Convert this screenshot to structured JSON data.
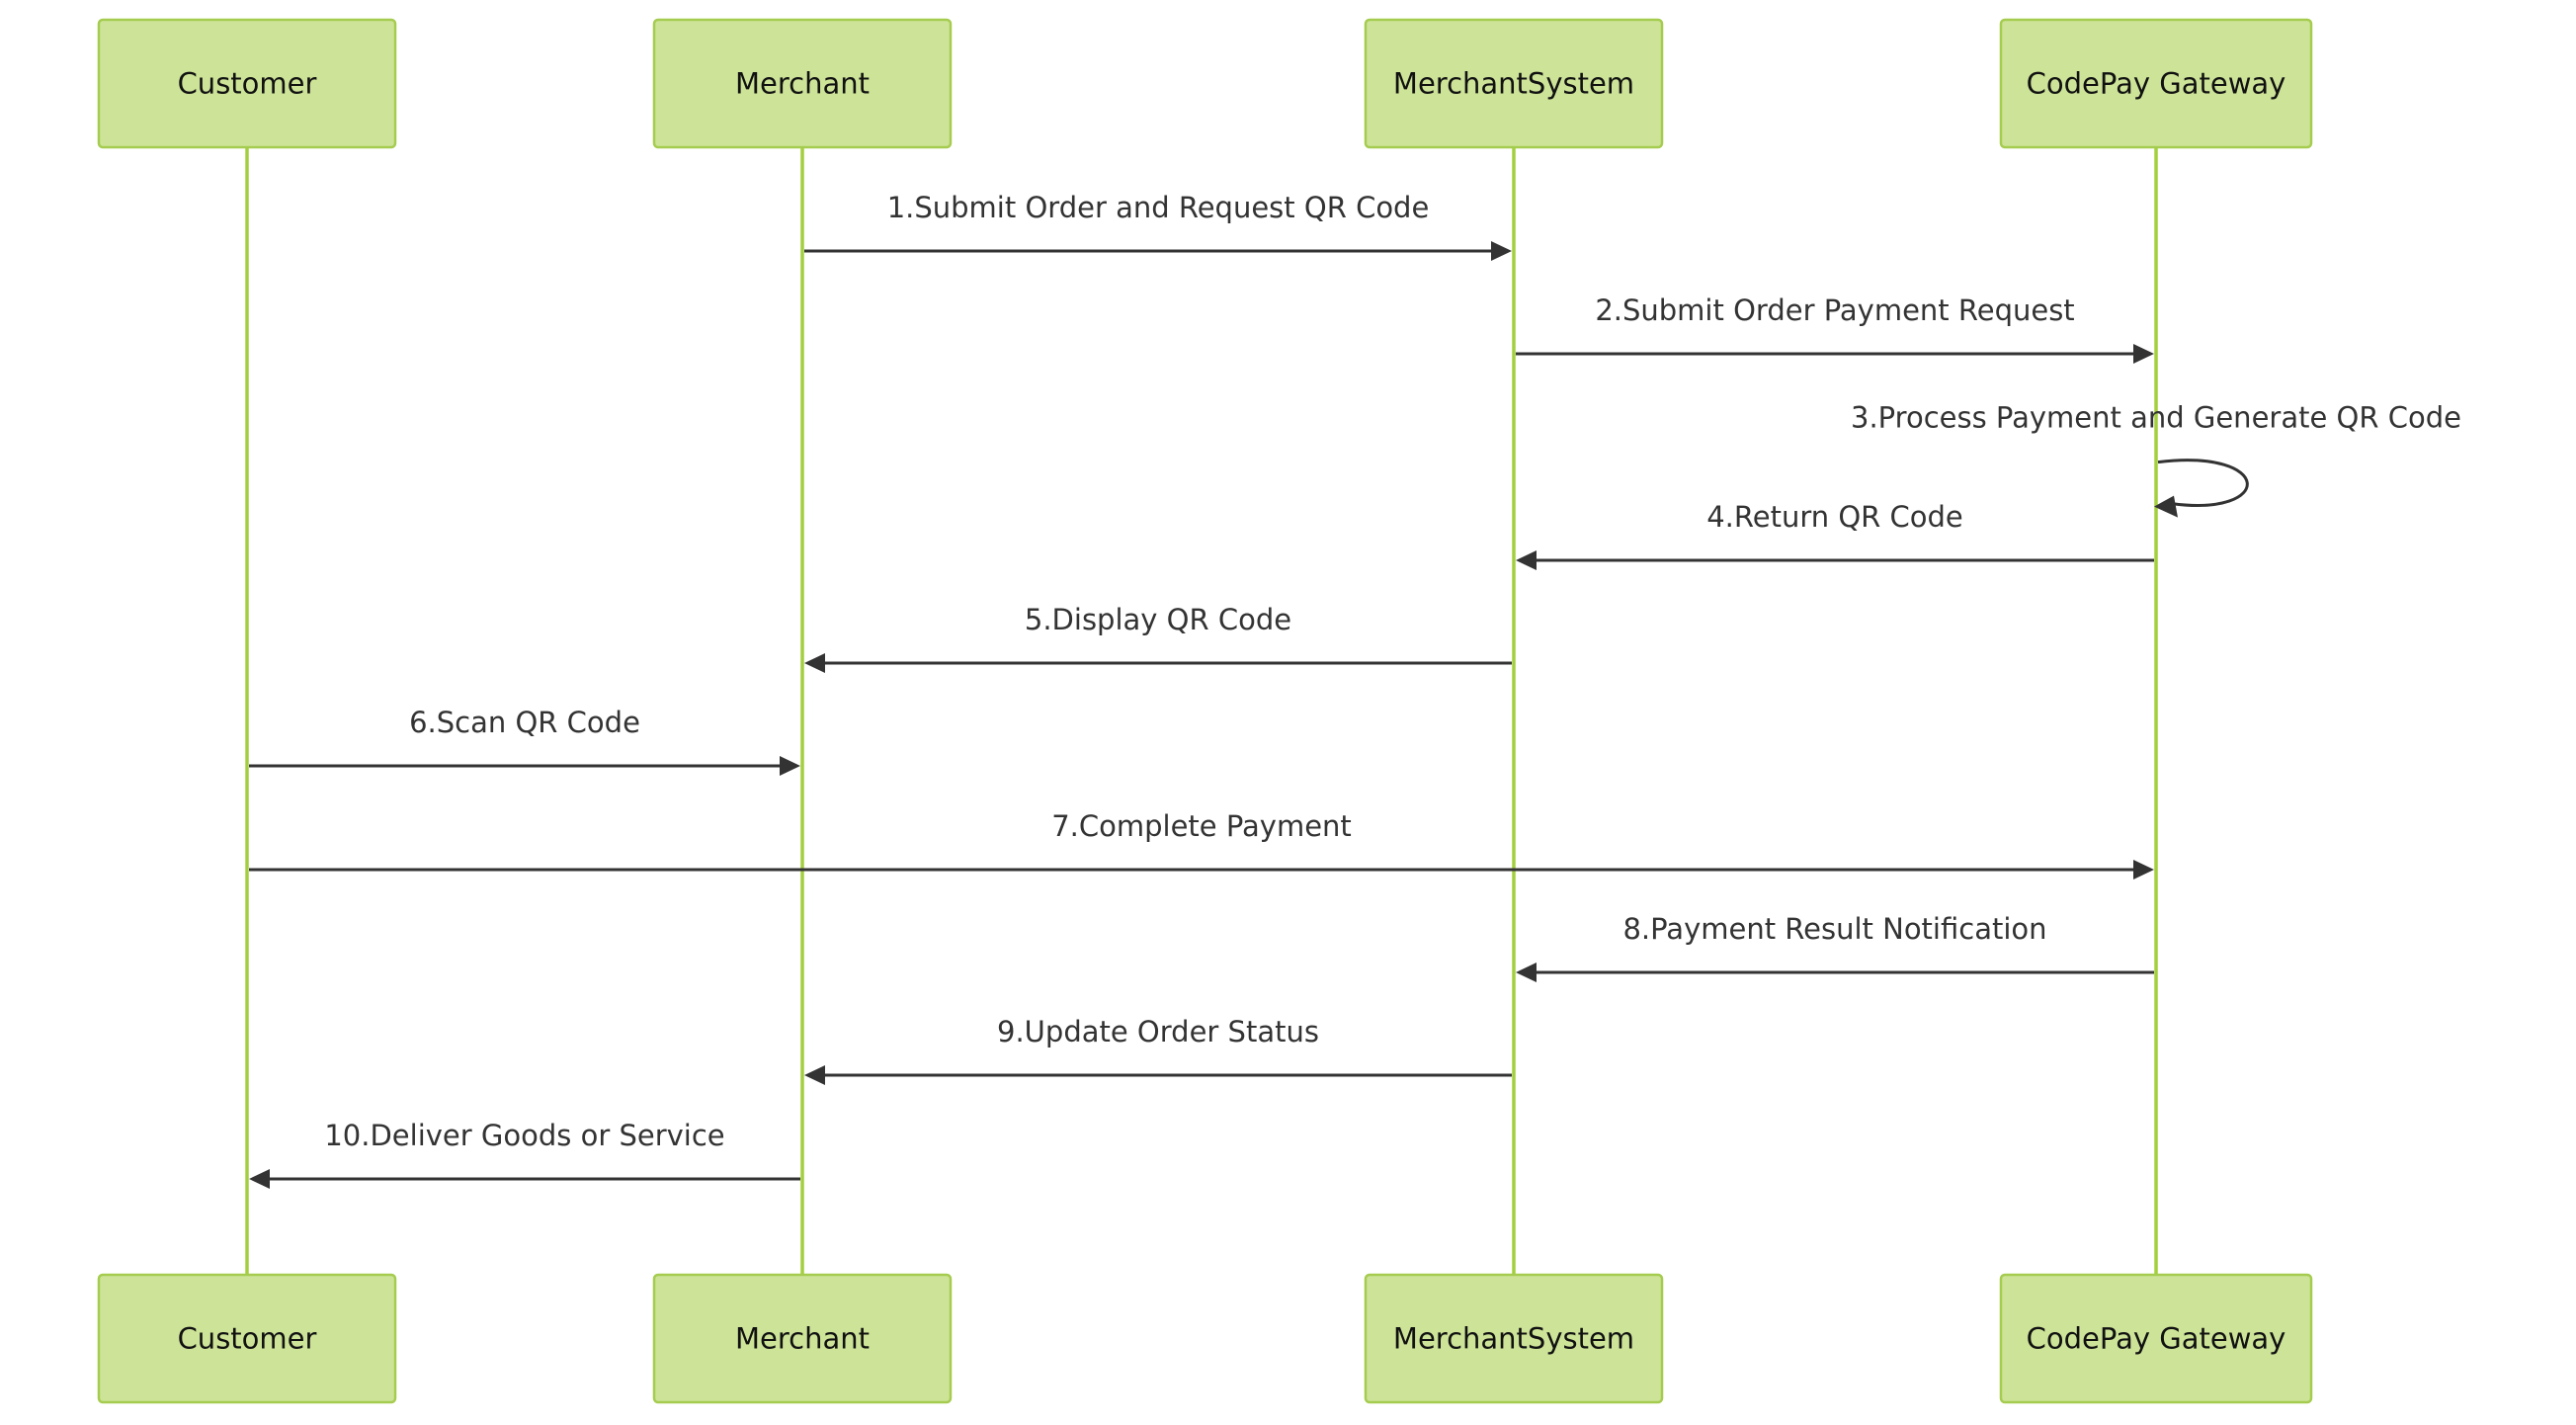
{
  "diagram": {
    "type": "sequence",
    "theme": {
      "actor_fill": "#cde498",
      "actor_stroke": "#a5cc4f",
      "lifeline": "#a3cf3f",
      "message": "#333333"
    },
    "participants": [
      {
        "id": "customer",
        "label": "Customer"
      },
      {
        "id": "merchant",
        "label": "Merchant"
      },
      {
        "id": "merchantsystem",
        "label": "MerchantSystem"
      },
      {
        "id": "codepay",
        "label": "CodePay Gateway"
      }
    ],
    "messages": [
      {
        "from": "merchant",
        "to": "merchantsystem",
        "label": "1.Submit Order and Request QR Code"
      },
      {
        "from": "merchantsystem",
        "to": "codepay",
        "label": "2.Submit Order Payment Request"
      },
      {
        "from": "codepay",
        "to": "codepay",
        "label": "3.Process Payment and Generate QR Code"
      },
      {
        "from": "codepay",
        "to": "merchantsystem",
        "label": "4.Return QR Code"
      },
      {
        "from": "merchantsystem",
        "to": "merchant",
        "label": "5.Display QR Code"
      },
      {
        "from": "customer",
        "to": "merchant",
        "label": "6.Scan QR Code"
      },
      {
        "from": "customer",
        "to": "codepay",
        "label": "7.Complete Payment"
      },
      {
        "from": "codepay",
        "to": "merchantsystem",
        "label": "8.Payment Result Notification"
      },
      {
        "from": "merchantsystem",
        "to": "merchant",
        "label": "9.Update Order Status"
      },
      {
        "from": "merchant",
        "to": "customer",
        "label": "10.Deliver Goods or Service"
      }
    ]
  }
}
